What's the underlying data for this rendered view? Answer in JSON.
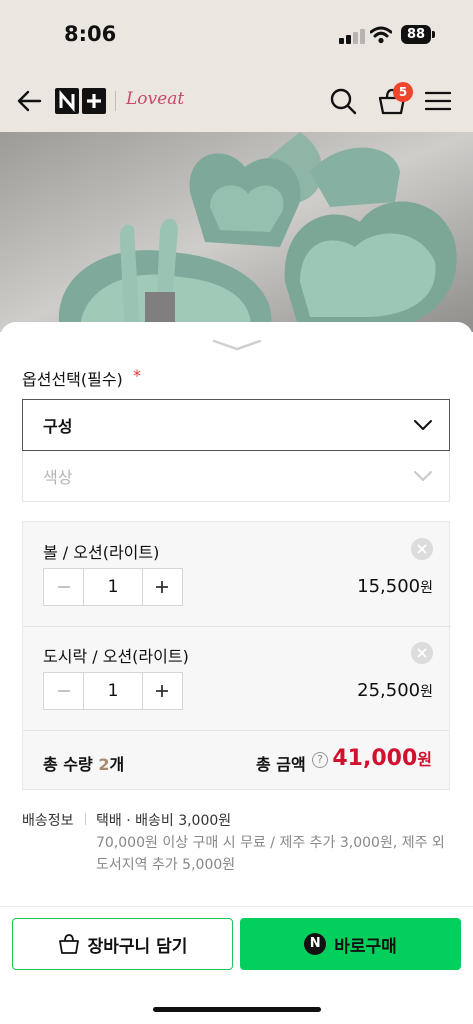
{
  "status": {
    "time": "8:06",
    "battery": "88"
  },
  "nav": {
    "brand": "Loveat",
    "cart_count": "5"
  },
  "options": {
    "title": "옵션선택(필수)",
    "required_mark": "*",
    "select_primary": "구성",
    "select_secondary": "색상"
  },
  "items": [
    {
      "name": "볼 / 오션(라이트)",
      "qty": "1",
      "price": "15,500",
      "currency": "원"
    },
    {
      "name": "도시락 / 오션(라이트)",
      "qty": "1",
      "price": "25,500",
      "currency": "원"
    }
  ],
  "total": {
    "qty_label": "총 수량",
    "qty_count": "2",
    "qty_unit": "개",
    "amount_label": "총 금액",
    "help": "?",
    "amount": "41,000",
    "currency": "원"
  },
  "shipping": {
    "label": "배송정보",
    "main": "택배 · 배송비 3,000원",
    "note": "70,000원 이상 구매 시 무료 / 제주 추가 3,000원, 제주 외 도서지역 추가 5,000원"
  },
  "actions": {
    "cart_label": "장바구니 담기",
    "buy_label": "바로구매",
    "buy_icon": "N"
  }
}
